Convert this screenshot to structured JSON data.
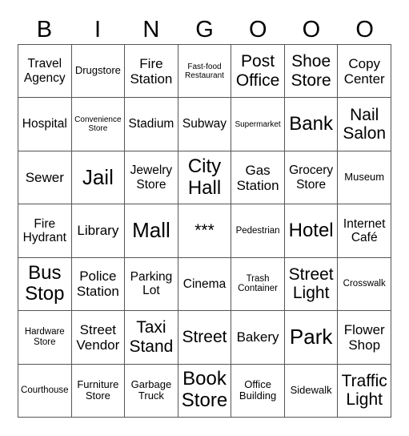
{
  "header": {
    "letters": [
      "B",
      "I",
      "N",
      "G",
      "O",
      "O",
      "O"
    ]
  },
  "cells": [
    [
      "Travel Agency",
      "Drugstore",
      "Fire Station",
      "Fast-food Restaurant",
      "Post Office",
      "Shoe Store",
      "Copy Center"
    ],
    [
      "Hospital",
      "Convenience Store",
      "Stadium",
      "Subway",
      "Supermarket",
      "Bank",
      "Nail Salon"
    ],
    [
      "Sewer",
      "Jail",
      "Jewelry Store",
      "City Hall",
      "Gas Station",
      "Grocery Store",
      "Museum"
    ],
    [
      "Fire Hydrant",
      "Library",
      "Mall",
      "***",
      "Pedestrian",
      "Hotel",
      "Internet Café"
    ],
    [
      "Bus Stop",
      "Police Station",
      "Parking Lot",
      "Cinema",
      "Trash Container",
      "Street Light",
      "Crosswalk"
    ],
    [
      "Hardware Store",
      "Street Vendor",
      "Taxi Stand",
      "Street",
      "Bakery",
      "Park",
      "Flower Shop"
    ],
    [
      "Courthouse",
      "Furniture Store",
      "Garbage Truck",
      "Book Store",
      "Office Building",
      "Sidewalk",
      "Traffic Light"
    ]
  ]
}
